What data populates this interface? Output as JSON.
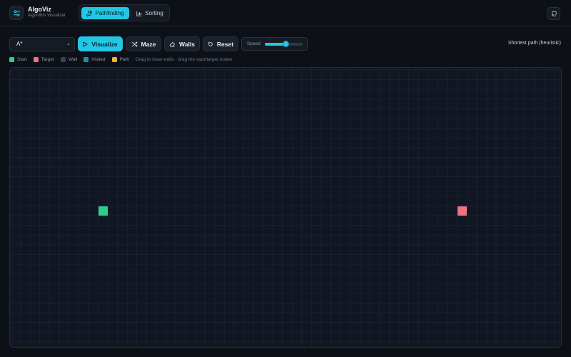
{
  "header": {
    "app_title": "AlgoViz",
    "app_subtitle": "Algorithm Visualizer",
    "logo_icon": "sliders-icon",
    "modes": [
      {
        "label": "Pathfinding",
        "icon": "route-icon",
        "active": true
      },
      {
        "label": "Sorting",
        "icon": "bar-chart-icon",
        "active": false
      }
    ],
    "github_icon": "github-icon"
  },
  "toolbar": {
    "algorithm_selected": "A*",
    "visualize_label": "Visualize",
    "maze_label": "Maze",
    "walls_label": "Walls",
    "reset_label": "Reset",
    "speed_label": "Speed",
    "speed_value": 0.55,
    "algorithm_description": "Shortest path (heuristic)"
  },
  "legend": {
    "items": [
      {
        "label": "Start",
        "color": "#2ecc8f"
      },
      {
        "label": "Target",
        "color": "#f0727f"
      },
      {
        "label": "Wall",
        "color": "#3a4350"
      },
      {
        "label": "Visited",
        "color": "#1e8ea8"
      },
      {
        "label": "Path",
        "color": "#f2b43a"
      }
    ],
    "hint": "Drag to draw walls · drag the start/target nodes"
  },
  "grid": {
    "rows": 29,
    "cols": 57,
    "start": {
      "row": 14,
      "col": 9
    },
    "target": {
      "row": 14,
      "col": 46
    }
  },
  "colors": {
    "accent": "#22c7e6",
    "start": "#2ecc8f",
    "target": "#f0727f",
    "grid_line": "#1d2532"
  }
}
